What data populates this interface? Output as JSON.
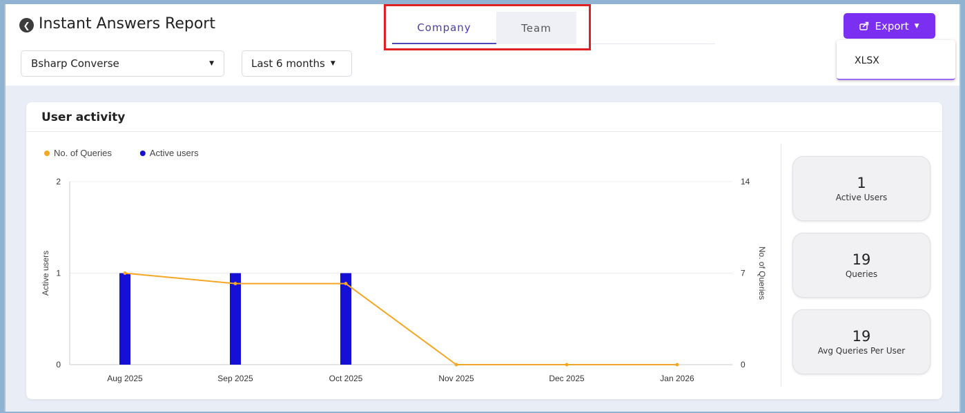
{
  "header": {
    "title": "Instant Answers Report",
    "tabs": [
      {
        "label": "Company",
        "active": true
      },
      {
        "label": "Team",
        "active": false
      }
    ],
    "export": {
      "label": "Export",
      "menu_items": [
        "XLSX"
      ]
    }
  },
  "filters": {
    "company": "Bsharp Converse",
    "range": "Last 6 months"
  },
  "user_activity": {
    "title": "User activity",
    "stats": [
      {
        "value": "1",
        "label": "Active Users"
      },
      {
        "value": "19",
        "label": "Queries"
      },
      {
        "value": "19",
        "label": "Avg Queries Per User"
      }
    ]
  },
  "colors": {
    "accent": "#7b2ff0",
    "bar": "#1411d4",
    "line": "#f5a623",
    "highlight": "#e02020"
  },
  "chart_data": {
    "type": "bar",
    "title": "",
    "categories": [
      "Aug 2025",
      "Sep 2025",
      "Oct 2025",
      "Nov 2025",
      "Dec 2025",
      "Jan 2026"
    ],
    "series": [
      {
        "name": "No. of Queries",
        "type": "line",
        "axis": "right",
        "color": "#f5a623",
        "values": [
          7,
          6.2,
          6.2,
          0,
          0,
          0
        ]
      },
      {
        "name": "Active users",
        "type": "bar",
        "axis": "left",
        "color": "#1411d4",
        "values": [
          1,
          1,
          1,
          0,
          0,
          0
        ]
      }
    ],
    "ylabel": "Active users",
    "ylabel_right": "No. of Queries",
    "ylim": [
      0,
      2
    ],
    "ylim_right": [
      0,
      14
    ],
    "yticks": [
      0,
      1,
      2
    ],
    "yticks_right": [
      0,
      7,
      14
    ],
    "legend": "top-left",
    "grid": true
  }
}
